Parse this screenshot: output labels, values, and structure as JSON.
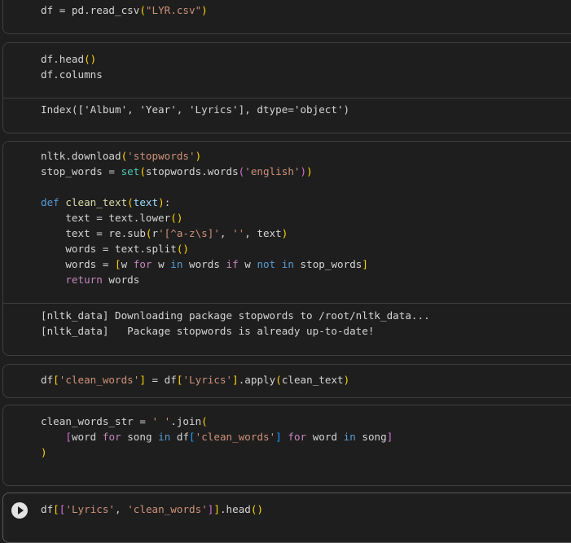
{
  "cells": [
    {
      "lines": [
        [
          [
            "df = pd.read_csv",
            "def"
          ],
          [
            "(",
            "b1"
          ],
          [
            "\"LYR.csv\"",
            "str"
          ],
          [
            ")",
            "b1"
          ]
        ]
      ],
      "output": []
    },
    {
      "lines": [
        [
          [
            "df.head",
            "def"
          ],
          [
            "()",
            "b1"
          ]
        ],
        [
          [
            "df.columns",
            "def"
          ]
        ],
        []
      ],
      "output": [
        "Index(['Album', 'Year', 'Lyrics'], dtype='object')"
      ]
    },
    {
      "lines": [
        [
          [
            "nltk.download",
            "def"
          ],
          [
            "(",
            "b1"
          ],
          [
            "'stopwords'",
            "str"
          ],
          [
            ")",
            "b1"
          ]
        ],
        [
          [
            "stop_words = ",
            "def"
          ],
          [
            "set",
            "bi"
          ],
          [
            "(",
            "b1"
          ],
          [
            "stopwords.words",
            "def"
          ],
          [
            "(",
            "b2"
          ],
          [
            "'english'",
            "str"
          ],
          [
            ")",
            "b2"
          ],
          [
            ")",
            "b1"
          ]
        ],
        [],
        [
          [
            "def ",
            "kw"
          ],
          [
            "clean_text",
            "fn"
          ],
          [
            "(",
            "b1"
          ],
          [
            "text",
            "par"
          ],
          [
            ")",
            "b1"
          ],
          [
            ":",
            "def"
          ]
        ],
        [
          [
            "    text = text.lower",
            "def"
          ],
          [
            "()",
            "b1"
          ]
        ],
        [
          [
            "    text = re.sub",
            "def"
          ],
          [
            "(",
            "b1"
          ],
          [
            "r",
            "def"
          ],
          [
            "'[^a-z\\s]'",
            "str"
          ],
          [
            ", ",
            "def"
          ],
          [
            "''",
            "str"
          ],
          [
            ", text",
            "def"
          ],
          [
            ")",
            "b1"
          ]
        ],
        [
          [
            "    words = text.split",
            "def"
          ],
          [
            "()",
            "b1"
          ]
        ],
        [
          [
            "    words = ",
            "def"
          ],
          [
            "[",
            "b1"
          ],
          [
            "w ",
            "def"
          ],
          [
            "for",
            "ctl"
          ],
          [
            " w ",
            "def"
          ],
          [
            "in",
            "kw"
          ],
          [
            " words ",
            "def"
          ],
          [
            "if",
            "ctl"
          ],
          [
            " w ",
            "def"
          ],
          [
            "not",
            "kw"
          ],
          [
            " ",
            "def"
          ],
          [
            "in",
            "kw"
          ],
          [
            " stop_words",
            "def"
          ],
          [
            "]",
            "b1"
          ]
        ],
        [
          [
            "    ",
            "def"
          ],
          [
            "return",
            "ctl"
          ],
          [
            " words",
            "def"
          ]
        ],
        []
      ],
      "output": [
        "[nltk_data] Downloading package stopwords to /root/nltk_data...",
        "[nltk_data]   Package stopwords is already up-to-date!"
      ]
    },
    {
      "lines": [
        [
          [
            "df",
            "def"
          ],
          [
            "[",
            "b1"
          ],
          [
            "'clean_words'",
            "str"
          ],
          [
            "]",
            "b1"
          ],
          [
            " = df",
            "def"
          ],
          [
            "[",
            "b1"
          ],
          [
            "'Lyrics'",
            "str"
          ],
          [
            "]",
            "b1"
          ],
          [
            ".apply",
            "def"
          ],
          [
            "(",
            "b1"
          ],
          [
            "clean_text",
            "def"
          ],
          [
            ")",
            "b1"
          ]
        ]
      ],
      "output": []
    },
    {
      "lines": [
        [
          [
            "clean_words_str = ",
            "def"
          ],
          [
            "' '",
            "str"
          ],
          [
            ".join",
            "def"
          ],
          [
            "(",
            "b1"
          ]
        ],
        [
          [
            "    ",
            "def"
          ],
          [
            "[",
            "b2"
          ],
          [
            "word ",
            "def"
          ],
          [
            "for",
            "ctl"
          ],
          [
            " song ",
            "def"
          ],
          [
            "in",
            "kw"
          ],
          [
            " df",
            "def"
          ],
          [
            "[",
            "b3"
          ],
          [
            "'clean_words'",
            "str"
          ],
          [
            "]",
            "b3"
          ],
          [
            " ",
            "def"
          ],
          [
            "for",
            "ctl"
          ],
          [
            " word ",
            "def"
          ],
          [
            "in",
            "kw"
          ],
          [
            " song",
            "def"
          ],
          [
            "]",
            "b2"
          ]
        ],
        [
          [
            ")",
            "b1"
          ]
        ],
        []
      ],
      "output": []
    },
    {
      "lines": [
        [
          [
            "df",
            "def"
          ],
          [
            "[",
            "b1"
          ],
          [
            "[",
            "b2"
          ],
          [
            "'Lyrics'",
            "str"
          ],
          [
            ", ",
            "def"
          ],
          [
            "'clean_words'",
            "str"
          ],
          [
            "]",
            "b2"
          ],
          [
            "]",
            "b1"
          ],
          [
            ".head",
            "def"
          ],
          [
            "()",
            "b1"
          ]
        ]
      ],
      "output": []
    }
  ]
}
